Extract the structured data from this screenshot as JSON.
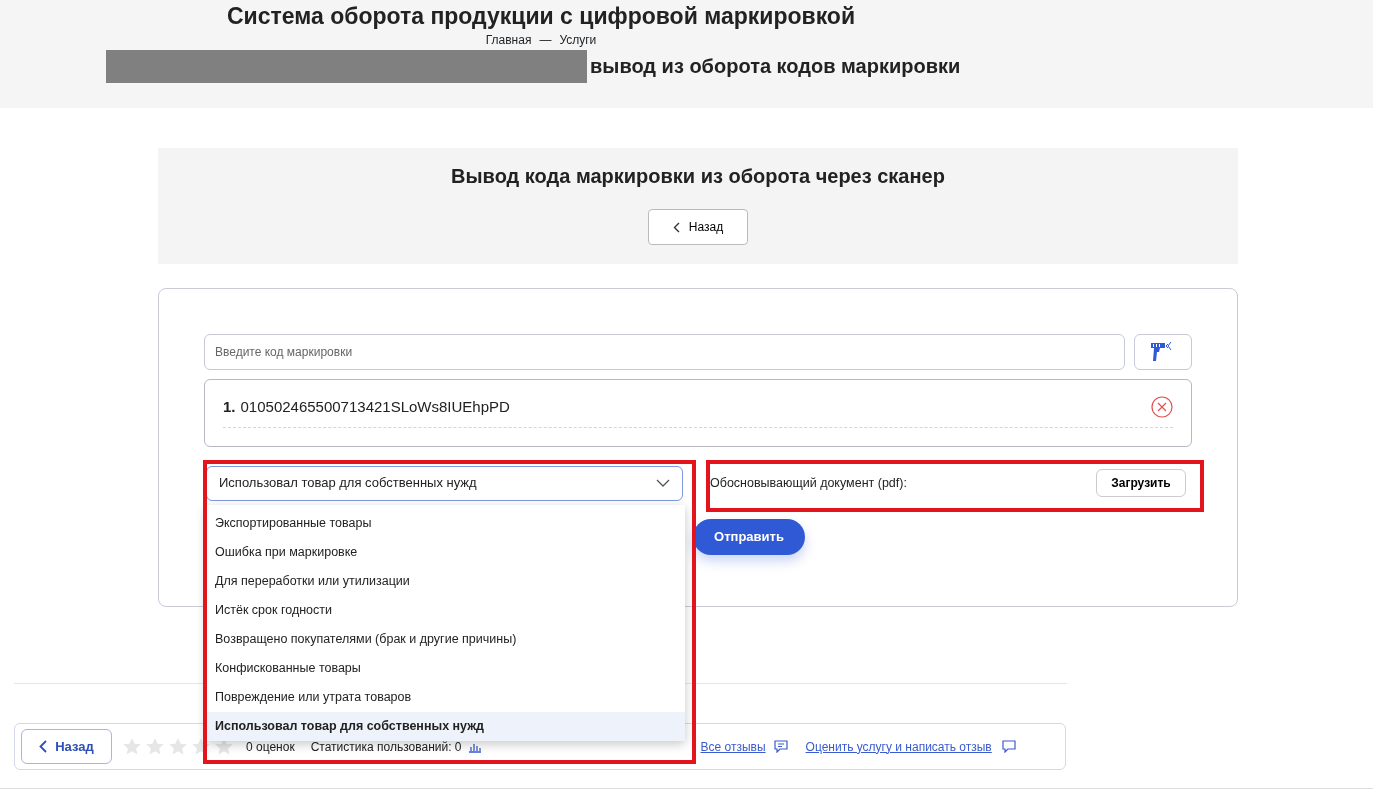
{
  "header": {
    "title": "Система оборота продукции с цифровой маркировкой",
    "breadcrumbs": [
      "Главная",
      "Услуги"
    ],
    "separator": "—",
    "subtitle": "вывод из оборота кодов маркировки"
  },
  "panel": {
    "title": "Вывод кода маркировки из оборота через сканер",
    "back_button": "Назад"
  },
  "form": {
    "code_input": {
      "placeholder": "Введите код маркировки"
    },
    "codes": [
      {
        "number": "1.",
        "code": "010502465500713421SLoWs8IUEhpPD"
      }
    ],
    "reason_select": {
      "value": "Использовал товар для собственных нужд",
      "expanded": true,
      "options": [
        {
          "label": "Экспортированные товары",
          "selected": false
        },
        {
          "label": "Ошибка при маркировке",
          "selected": false
        },
        {
          "label": "Для переработки или утилизации",
          "selected": false
        },
        {
          "label": "Истёк срок годности",
          "selected": false
        },
        {
          "label": "Возвращено покупателями (брак и другие причины)",
          "selected": false
        },
        {
          "label": "Конфискованные товары",
          "selected": false
        },
        {
          "label": "Повреждение или утрата товаров",
          "selected": false
        },
        {
          "label": "Использовал товар для собственных нужд",
          "selected": true
        }
      ]
    },
    "document": {
      "label": "Обосновывающий документ (pdf):",
      "upload_button": "Загрузить"
    },
    "submit_button": "Отправить"
  },
  "footer": {
    "back_button": "Назад",
    "stars": 0,
    "ratings": "0 оценок",
    "usage": "Статистика пользований: 0",
    "links": [
      "Все отзывы",
      "Оценить услугу и написать отзыв"
    ]
  }
}
